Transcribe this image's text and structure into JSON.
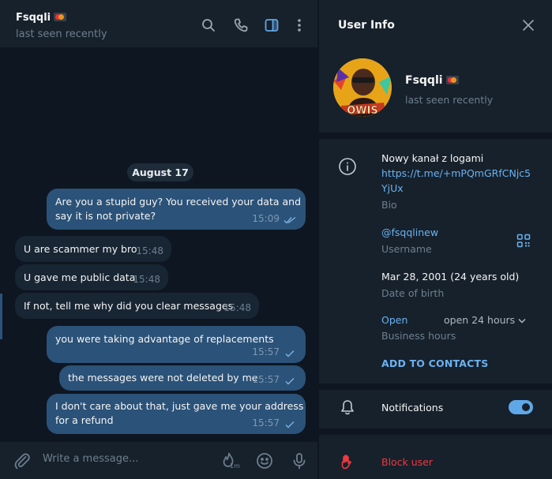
{
  "chat": {
    "header": {
      "name": "Fsqqli",
      "status": "last seen recently",
      "icons": [
        "search-icon",
        "phone-icon",
        "sidebar-toggle-icon",
        "more-vertical-icon"
      ]
    },
    "date_separator": "August 17",
    "messages": [
      {
        "direction": "out",
        "text_lines": [
          "Are you a stupid guy? You received your data and",
          "say it is not private?"
        ],
        "time": "15:09",
        "status": "read"
      },
      {
        "direction": "in",
        "text": "U are scammer my bro",
        "time": "15:48"
      },
      {
        "direction": "in",
        "text": "U gave me public data",
        "time": "15:48"
      },
      {
        "direction": "in",
        "text": "If not, tell me why did you clear messages",
        "time": "15:48"
      },
      {
        "direction": "out",
        "text": "you were taking advantage of replacements",
        "time": "15:57",
        "status": "sent"
      },
      {
        "direction": "out",
        "text": "the messages were not deleted by me",
        "time": "15:57",
        "status": "sent"
      },
      {
        "direction": "out",
        "text_lines": [
          "I don't care about that, just gave me your address",
          "for a refund"
        ],
        "time": "15:57",
        "status": "sent"
      }
    ],
    "composer": {
      "placeholder": "Write a message...",
      "timer_label": "1m",
      "icons": [
        "attach-icon",
        "self-destruct-timer-icon",
        "emoji-icon",
        "microphone-icon"
      ]
    }
  },
  "info": {
    "title": "User Info",
    "name": "Fsqqli",
    "status": "last seen recently",
    "bio_text": "Nowy kanał z logami",
    "bio_link_line1": "https://t.me/+mPQmGRfCNjc5",
    "bio_link_line2": "YjUx",
    "bio_label": "Bio",
    "username": "@fsqqlinew",
    "username_label": "Username",
    "birth_date": "Mar 28, 2001 (24 years old)",
    "birth_label": "Date of birth",
    "hours_status": "Open",
    "hours_value": "open 24 hours",
    "hours_label": "Business hours",
    "add_contacts": "ADD TO CONTACTS",
    "notifications_label": "Notifications",
    "notifications_enabled": true,
    "block_user": "Block user"
  },
  "colors": {
    "background": "#0e1621",
    "panel": "#17212b",
    "outgoing_bubble": "#2b5278",
    "incoming_bubble": "#182533",
    "accent": "#6ab2f2",
    "danger": "#ec3942"
  }
}
